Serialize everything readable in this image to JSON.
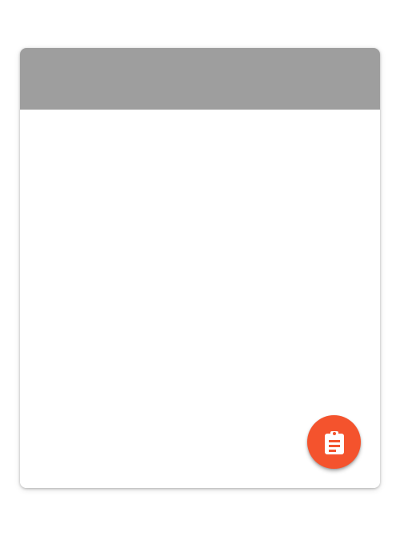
{
  "colors": {
    "header": "#9e9e9e",
    "card": "#ffffff",
    "page_background": "#ffffff",
    "fab": "#f4532d",
    "fab_icon": "#ffffff"
  },
  "fab": {
    "icon": "clipboard-icon"
  }
}
